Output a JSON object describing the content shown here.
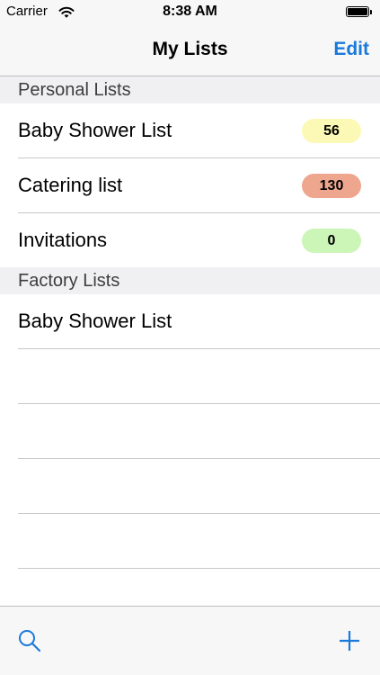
{
  "status_bar": {
    "carrier": "Carrier",
    "time": "8:38 AM",
    "battery_level": 1.0
  },
  "nav": {
    "title": "My Lists",
    "edit_label": "Edit"
  },
  "sections": [
    {
      "title": "Personal Lists",
      "rows": [
        {
          "label": "Baby Shower List",
          "badge": "56",
          "badge_color": "#fbf9b5"
        },
        {
          "label": "Catering list",
          "badge": "130",
          "badge_color": "#efa68e"
        },
        {
          "label": "Invitations",
          "badge": "0",
          "badge_color": "#ccf5b8"
        }
      ]
    },
    {
      "title": "Factory Lists",
      "rows": [
        {
          "label": "Baby Shower List"
        }
      ]
    }
  ],
  "empty_rows": 4,
  "toolbar": {
    "left_icon": "search-icon",
    "right_icon": "plus-icon"
  },
  "colors": {
    "accent": "#1a79d9",
    "bar_background": "#f7f7f8",
    "section_background": "#f0f0f2",
    "separator": "#c8c7cc"
  }
}
